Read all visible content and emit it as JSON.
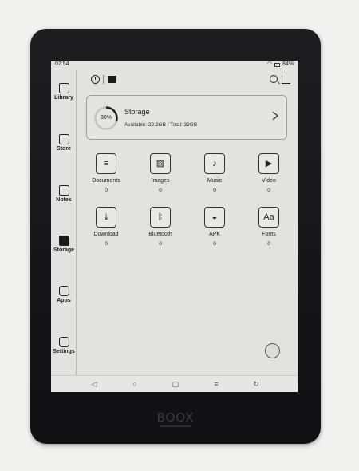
{
  "status": {
    "time": "07:54",
    "battery": "84%"
  },
  "sidebar": {
    "items": [
      {
        "label": "Library",
        "icon": "book-icon"
      },
      {
        "label": "Store",
        "icon": "store-icon"
      },
      {
        "label": "Notes",
        "icon": "note-pen-icon"
      },
      {
        "label": "Storage",
        "icon": "folder-icon",
        "active": true
      },
      {
        "label": "Apps",
        "icon": "apps-hexagon-icon"
      },
      {
        "label": "Settings",
        "icon": "gear-hexagon-icon"
      }
    ]
  },
  "storage": {
    "percent": "30%",
    "used_fraction": 0.3,
    "title": "Storage",
    "detail": "Available: 22.2GB / Total: 32GB"
  },
  "categories": [
    {
      "label": "Documents",
      "count": "0",
      "icon": "document-icon"
    },
    {
      "label": "Images",
      "count": "0",
      "icon": "image-icon"
    },
    {
      "label": "Music",
      "count": "0",
      "icon": "music-note-icon"
    },
    {
      "label": "Video",
      "count": "0",
      "icon": "video-icon"
    },
    {
      "label": "Download",
      "count": "0",
      "icon": "download-icon"
    },
    {
      "label": "Bluetooth",
      "count": "0",
      "icon": "bluetooth-icon"
    },
    {
      "label": "APK",
      "count": "0",
      "icon": "android-icon"
    },
    {
      "label": "Fonts",
      "count": "0",
      "icon": "fonts-icon",
      "glyph": "Aa"
    }
  ],
  "brand": "BOOX"
}
